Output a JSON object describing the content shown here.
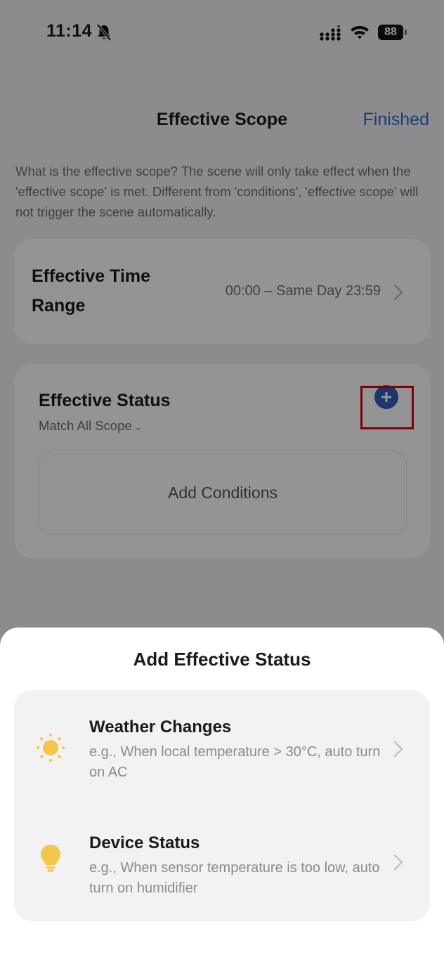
{
  "status_bar": {
    "time": "11:14",
    "battery": "88"
  },
  "header": {
    "title": "Effective Scope",
    "finish_label": "Finished"
  },
  "description": "What is the effective scope? The scene will only take effect when the 'effective scope' is met. Different from 'conditions', 'effective scope' will not trigger the scene automatically.",
  "time_range": {
    "label": "Effective Time Range",
    "value": "00:00 – Same Day 23:59"
  },
  "effective_status": {
    "title": "Effective Status",
    "match_label": "Match All Scope",
    "add_conditions_label": "Add Conditions"
  },
  "sheet": {
    "title": "Add Effective Status",
    "options": [
      {
        "title": "Weather Changes",
        "description": "e.g., When local temperature > 30°C, auto turn on AC",
        "icon": "sun-icon"
      },
      {
        "title": "Device Status",
        "description": "e.g., When sensor temperature is too low, auto turn on humidifier",
        "icon": "lightbulb-icon"
      }
    ]
  },
  "colors": {
    "accent": "#2f6cd6",
    "add_button": "#2f5fb8",
    "highlight": "#e00000",
    "sun": "#f4c64a"
  }
}
